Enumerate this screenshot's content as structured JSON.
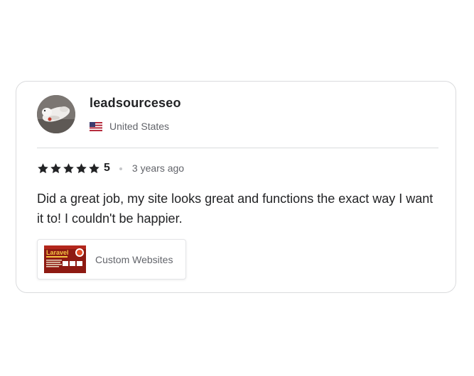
{
  "review": {
    "username": "leadsourceseo",
    "country": "United States",
    "rating": "5",
    "time_ago": "3 years ago",
    "text": "Did a great job, my site looks great and functions the exact way I want it to! I couldn't be happier.",
    "stars_count": 5,
    "star_icon": "star-icon",
    "flag_icon": "us-flag-icon"
  },
  "gig": {
    "label": "Custom Websites",
    "thumb_text": "Laravel"
  },
  "colors": {
    "text_primary": "#222325",
    "text_secondary": "#62646a",
    "border": "#dadbdd",
    "star": "#222325"
  }
}
